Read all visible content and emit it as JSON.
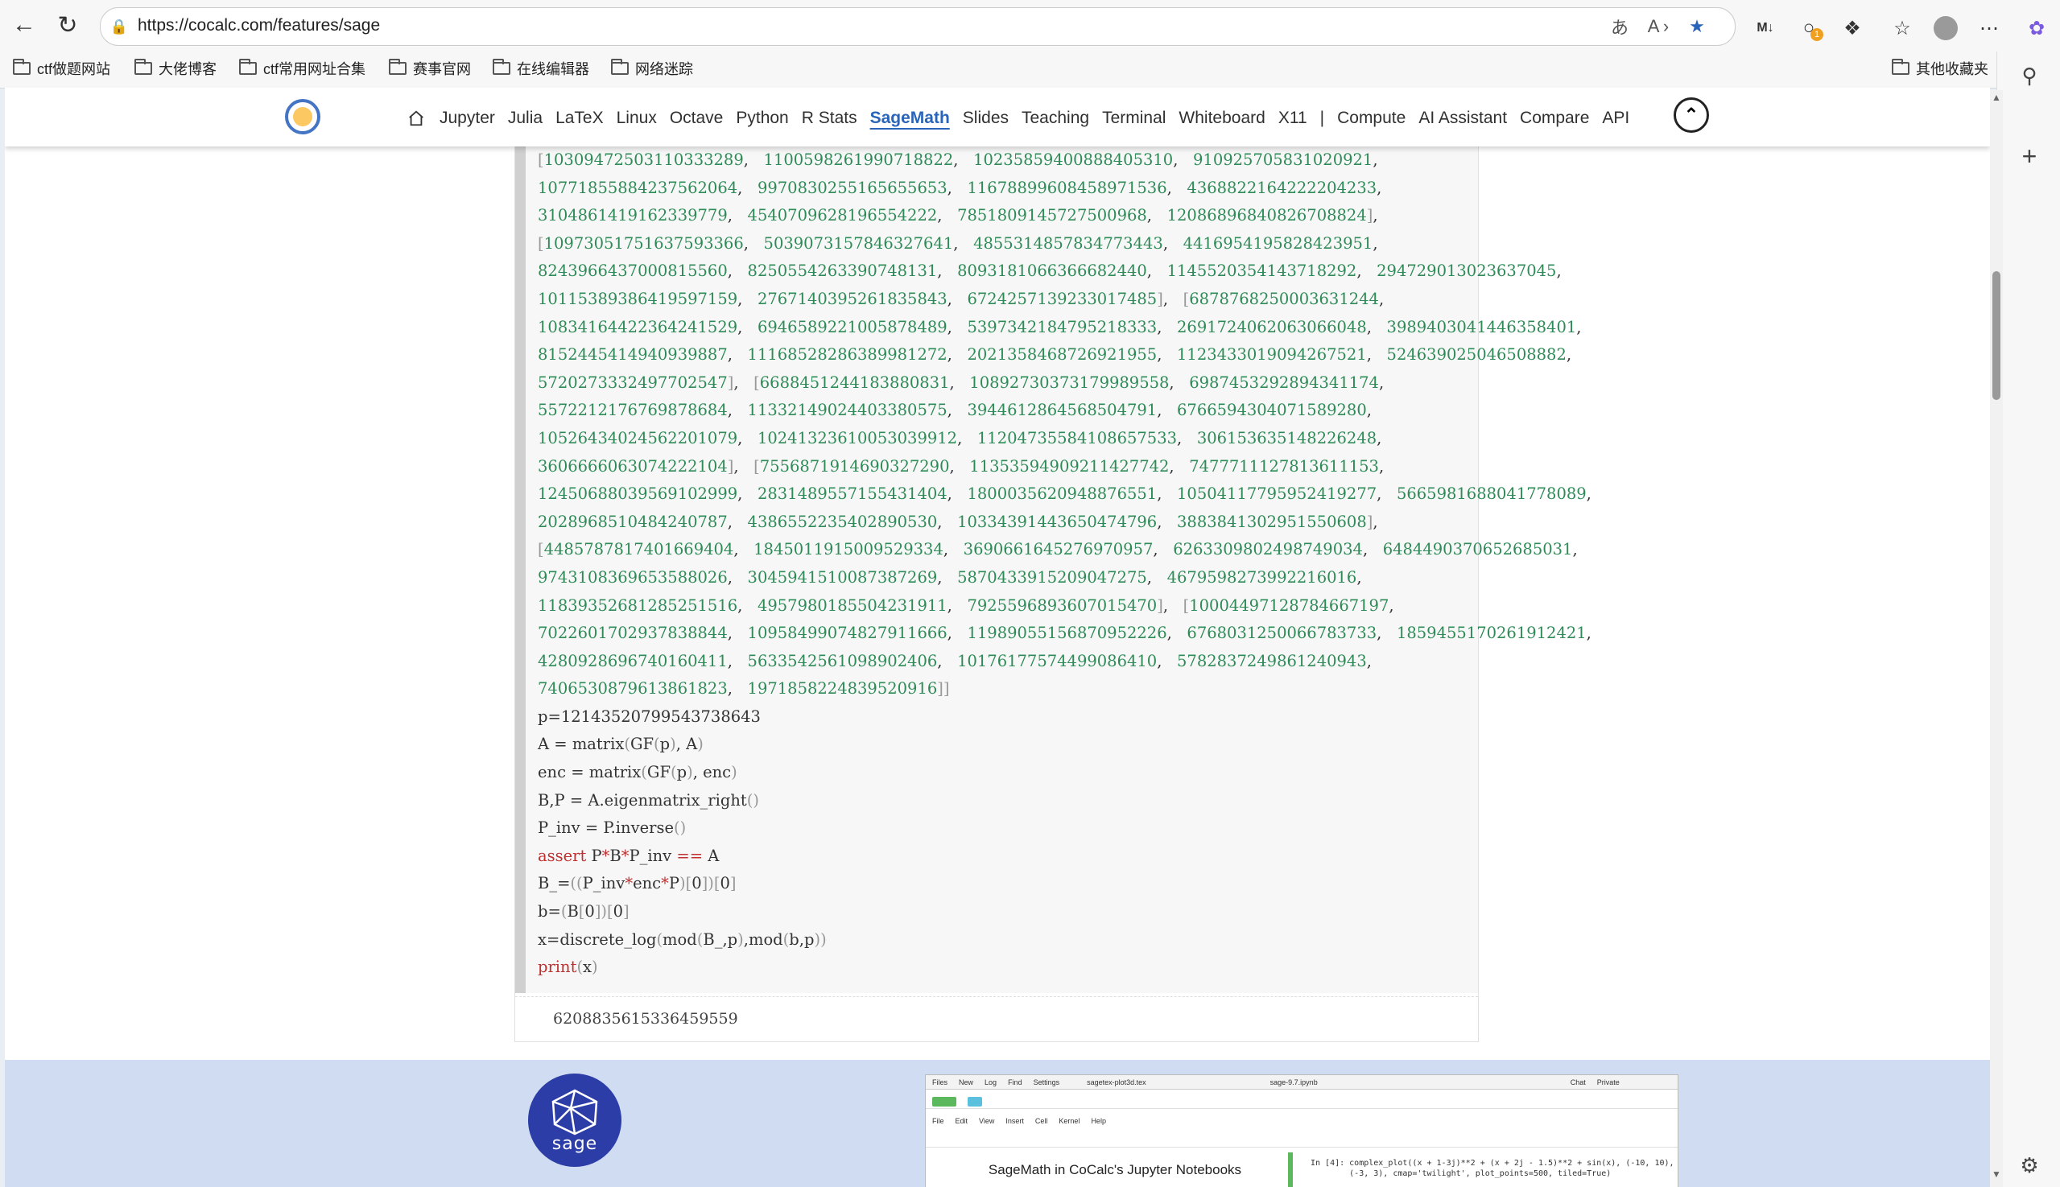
{
  "browser": {
    "url": "https://cocalc.com/features/sage",
    "bookmarks": [
      "ctf做题网站",
      "大佬博客",
      "ctf常用网址合集",
      "赛事官网",
      "在线编辑器",
      "网络迷踪"
    ],
    "other_bookmarks": "其他收藏夹",
    "notification_count": "1"
  },
  "nav": {
    "items": [
      "Jupyter",
      "Julia",
      "LaTeX",
      "Linux",
      "Octave",
      "Python",
      "R Stats",
      "SageMath",
      "Slides",
      "Teaching",
      "Terminal",
      "Whiteboard",
      "X11",
      "|",
      "Compute",
      "AI Assistant",
      "Compare",
      "API"
    ],
    "active": "SageMath"
  },
  "code": {
    "lines": [
      "[10309472503110333289, 1100598261990718822, 10235859400888405310, 910925705831020921,",
      "10771855884237562064, 9970830255165655653, 11678899608458971536, 4368822164222204233,",
      "3104861419162339779, 4540709628196554222, 7851809145727500968, 12086896840826708824],",
      "[10973051751637593366, 5039073157846327641, 4855314857834773443, 4416954195828423951,",
      "8243966437000815560, 8250554263390748131, 8093181066366682440, 1145520354143718292, 294729013023637045,",
      "10115389386419597159, 2767140395261835843, 6724257139233017485], [6878768250003631244,",
      "10834164422364241529, 6946589221005878489, 5397342184795218333, 2691724062063066048, 3989403041446358401,",
      "8152445414940939887, 11168528286389981272, 2021358468726921955, 1123433019094267521, 524639025046508882,",
      "5720273332497702547], [6688451244183880831, 10892730373179989558, 6987453292894341174,",
      "5572212176769878684, 11332149024403380575, 3944612864568504791, 6766594304071589280,",
      "10526434024562201079, 10241323610053039912, 11204735584108657533, 306153635148226248,",
      "3606666063074222104], [7556871914690327290, 11353594909211427742, 7477711127813611153,",
      "12450688039569102999, 2831489557155431404, 1800035620948876551, 10504117795952419277, 5665981688041778089,",
      "2028968510484240787, 4386552235402890530, 10334391443650474796, 3883841302951550608],",
      "[4485787817401669404, 1845011915009529334, 3690661645276970957, 6263309802498749034, 6484490370652685031,",
      "9743108369653588026, 3045941510087387269, 5870433915209047275, 4679598273992216016,",
      "11839352681285251516, 4957980185504231911, 7925596893607015470], [10004497128784667197,",
      "7022601702937838844, 10958499074827911666, 11989055156870952226, 6768031250066783733, 1859455170261912421,",
      "4280928696740160411, 5633542561098902406, 10176177574499086410, 5782837249861240943,",
      "7406530879613861823, 1971858224839520916]]",
      "p=12143520799543738643",
      "A = matrix(GF(p), A)",
      "enc = matrix(GF(p), enc)",
      "B,P = A.eigenmatrix_right()",
      "P_inv = P.inverse()",
      "assert P*B*P_inv == A",
      "B_=((P_inv*enc*P)[0])[0]",
      "b=(B[0])[0]",
      "x=discrete_log(mod(B_,p),mod(b,p))",
      "print(x)"
    ],
    "output": "6208835615336459559"
  },
  "feature": {
    "sage_logo_text": "sage",
    "caption": "SageMath in CoCalc's Jupyter Notebooks",
    "preview_tabs": [
      "Files",
      "New",
      "Log",
      "Find",
      "Settings",
      "sagetex-plot3d.tex",
      "sage-9.7.ipynb",
      "Chat",
      "Private"
    ],
    "preview_menu": [
      "File",
      "Edit",
      "View",
      "Insert",
      "Cell",
      "Kernel",
      "Help"
    ],
    "preview_code": "In [4]: complex_plot((x + 1-3j)**2 + (x + 2j - 1.5)**2 + sin(x), (-10, 10),\n        (-3, 3), cmap='twilight', plot_points=500, tiled=True)"
  }
}
